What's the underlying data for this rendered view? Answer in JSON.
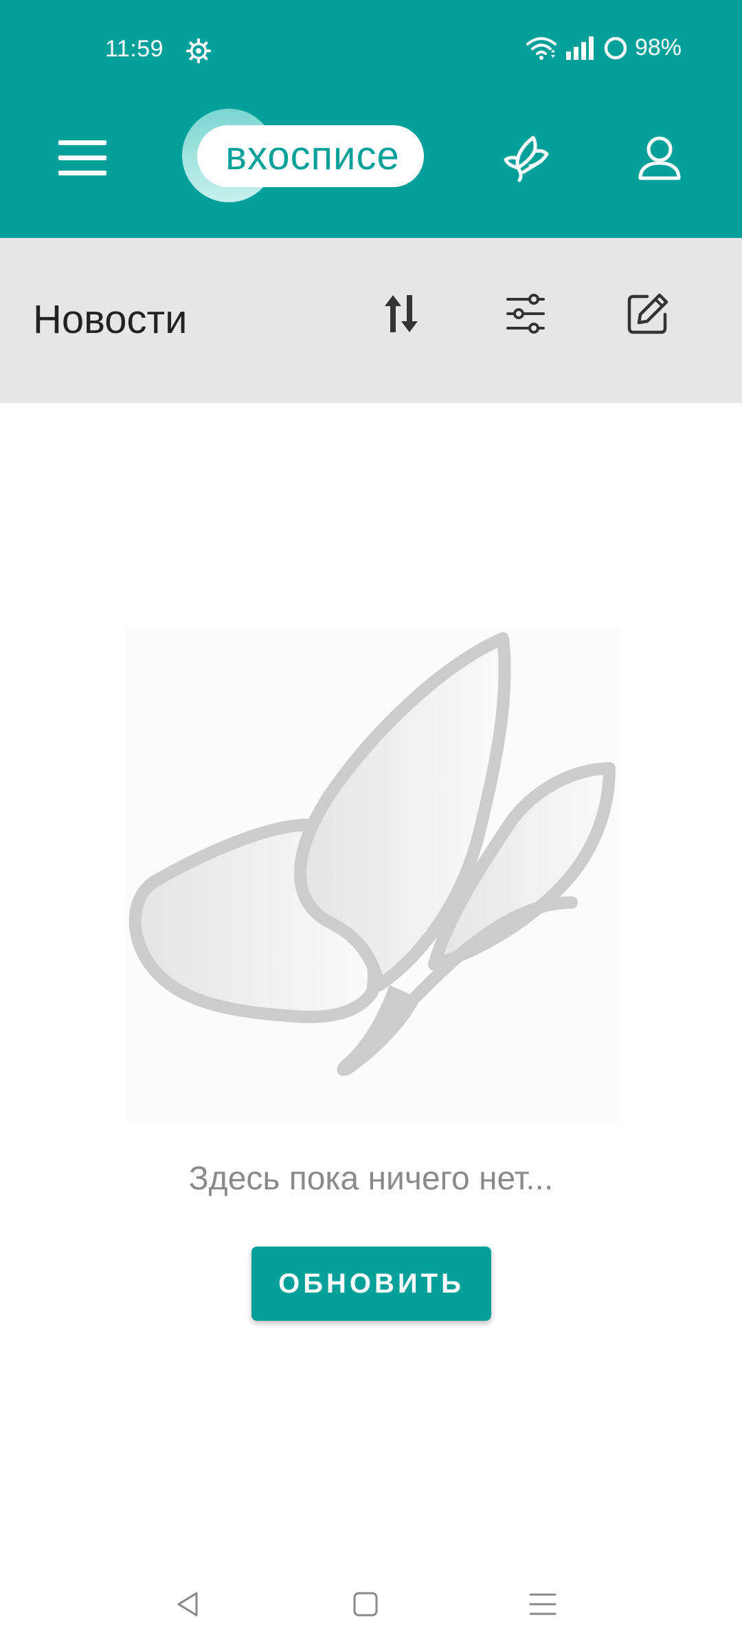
{
  "status_bar": {
    "time": "11:59",
    "battery_percent": "98%",
    "icons": [
      "gear-icon",
      "wifi-icon",
      "signal-icon",
      "battery-ring-icon"
    ]
  },
  "app_bar": {
    "logo_text": "вхосписе",
    "icons": [
      "hamburger-menu-icon",
      "leaf-icon",
      "profile-icon"
    ]
  },
  "toolbar": {
    "title": "Новости",
    "icons": [
      "sort-icon",
      "filter-sliders-icon",
      "edit-icon"
    ]
  },
  "empty_state": {
    "illustration": "butterfly-placeholder",
    "message": "Здесь пока ничего нет...",
    "refresh_label": "ОБНОВИТЬ"
  },
  "system_nav": {
    "icons": [
      "back-triangle-icon",
      "home-square-icon",
      "recents-lines-icon"
    ]
  },
  "colors": {
    "brand": "#05a09a",
    "toolbar_bg": "#e6e6e6",
    "placeholder_gray": "#cccccc",
    "empty_text": "#8a8a8a"
  }
}
